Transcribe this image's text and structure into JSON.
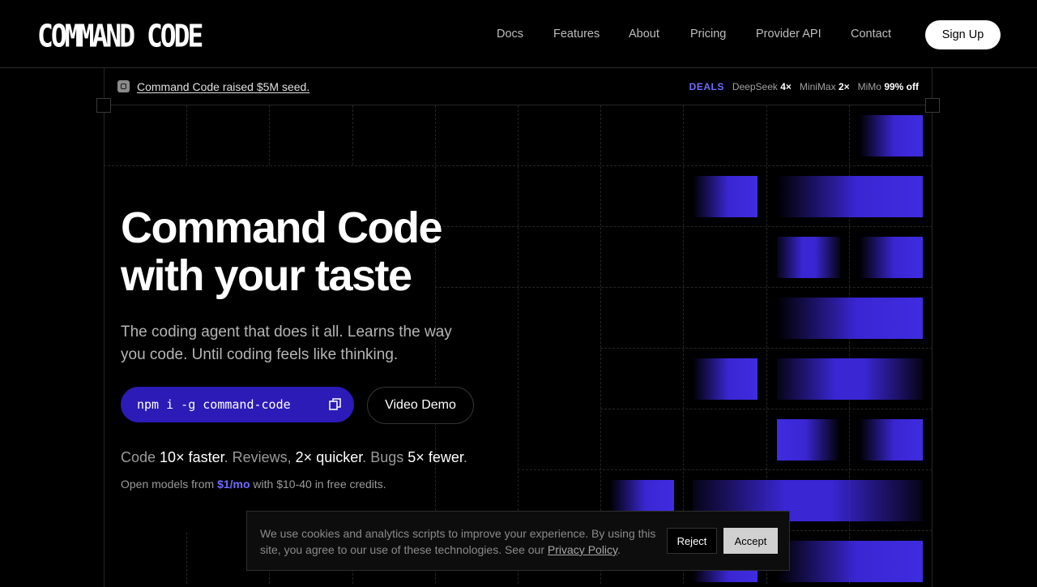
{
  "header": {
    "logo": "COMMAND CODE",
    "nav": [
      {
        "label": "Docs"
      },
      {
        "label": "Features"
      },
      {
        "label": "About"
      },
      {
        "label": "Pricing"
      },
      {
        "label": "Provider API"
      },
      {
        "label": "Contact"
      }
    ],
    "signup_label": "Sign Up"
  },
  "announcement": {
    "text": "Command Code raised $5M seed.",
    "deals_label": "DEALS",
    "deals": [
      {
        "name": "DeepSeek",
        "value": "4×"
      },
      {
        "name": "MiniMax",
        "value": "2×"
      },
      {
        "name": "MiMo",
        "value": "99% off"
      }
    ]
  },
  "hero": {
    "title_line1": "Command Code",
    "title_line2": "with your taste",
    "subtitle": "The coding agent that does it all. Learns the way you code. Until coding feels like thinking.",
    "install_command": "npm i -g command-code",
    "video_demo_label": "Video Demo",
    "stats": {
      "a_label": "Code",
      "a_value": "10× faster",
      "b_label": "Reviews,",
      "b_value": "2× quicker",
      "c_label": "Bugs",
      "c_value": "5× fewer"
    },
    "pricing_prefix": "Open models from",
    "pricing_price": "$1/mo",
    "pricing_suffix": "with $10-40 in free credits."
  },
  "cookie": {
    "text": "We use cookies and analytics scripts to improve your experience. By using this site, you agree to our use of these technologies. See our",
    "link": "Privacy Policy",
    "reject_label": "Reject",
    "accept_label": "Accept"
  },
  "colors": {
    "accent": "#6f6bff",
    "install_bg": "#2c1bb6",
    "block": "#3a26d2"
  }
}
